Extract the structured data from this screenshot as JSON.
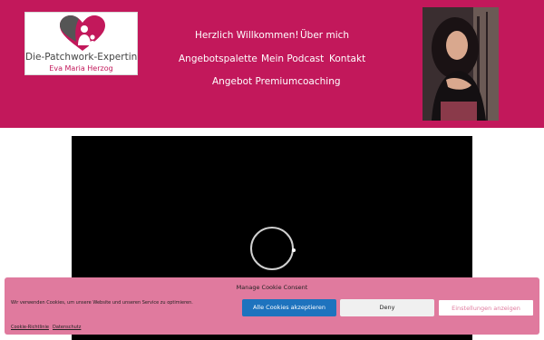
{
  "logo": {
    "title": "Die-Patchwork-Expertin",
    "subtitle": "Eva Maria Herzog"
  },
  "nav": {
    "items": [
      {
        "label": "Herzlich Willkommen!"
      },
      {
        "label": "Über mich"
      },
      {
        "label": "Angebotspalette"
      },
      {
        "label": "Mein Podcast"
      },
      {
        "label": "Kontakt"
      },
      {
        "label": "Angebot Premiumcoaching"
      }
    ]
  },
  "cookie": {
    "title": "Manage Cookie Consent",
    "message": "Wir verwenden Cookies, um unsere Website und unseren Service zu optimieren.",
    "accept": "Alle Cookies akzeptieren",
    "deny": "Deny",
    "settings": "Einstellungen anzeigen",
    "links": [
      "Cookie-Richtlinie",
      "Datenschutz"
    ]
  },
  "colors": {
    "header": "#c2185b",
    "cookie_banner": "#e07a9e",
    "accept_button": "#1e73be"
  },
  "icons": {
    "logo_mark": "heart-family-icon",
    "loading": "loading-spinner-icon"
  }
}
